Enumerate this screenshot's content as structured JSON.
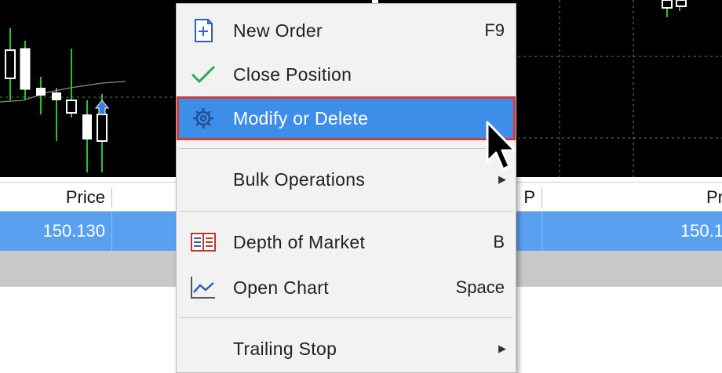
{
  "menu": {
    "items": [
      {
        "label": "New Order",
        "shortcut": "F9",
        "icon": "new-order-icon"
      },
      {
        "label": "Close Position",
        "shortcut": "",
        "icon": "checkmark-icon"
      },
      {
        "label": "Modify or Delete",
        "shortcut": "",
        "icon": "gear-icon",
        "highlighted": true
      },
      {
        "label": "Bulk Operations",
        "shortcut": "",
        "submenu": true
      },
      {
        "label": "Depth of Market",
        "shortcut": "B",
        "icon": "depth-of-market-icon"
      },
      {
        "label": "Open Chart",
        "shortcut": "Space",
        "icon": "open-chart-icon"
      },
      {
        "label": "Trailing Stop",
        "shortcut": "",
        "submenu": true
      }
    ]
  },
  "table": {
    "headers": {
      "price": "Price",
      "p": "P",
      "price2": "Pr"
    },
    "row": {
      "price": "150.130",
      "price2": "150.1"
    }
  },
  "colors": {
    "highlight": "#3d8ee8",
    "highlight_border": "#d43a3a",
    "selected_row": "#5aa0f0",
    "candle_green": "#27c427"
  }
}
